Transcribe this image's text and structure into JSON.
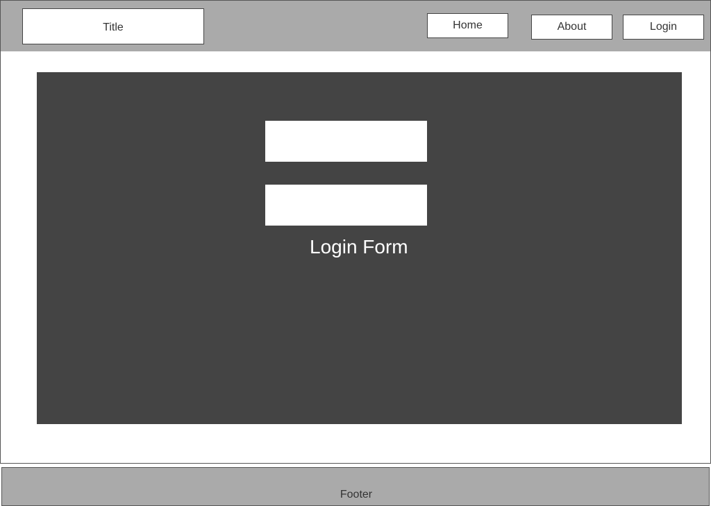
{
  "header": {
    "title": "Title",
    "nav": {
      "home_label": "Home",
      "about_label": "About",
      "login_label": "Login"
    }
  },
  "main": {
    "login_form": {
      "label": "Login Form",
      "field_1_value": "",
      "field_2_value": ""
    }
  },
  "footer": {
    "text": "Footer"
  },
  "colors": {
    "header_bg": "#aaaaaa",
    "panel_bg": "#444444",
    "footer_bg": "#aaaaaa",
    "page_bg": "#ffffff"
  }
}
